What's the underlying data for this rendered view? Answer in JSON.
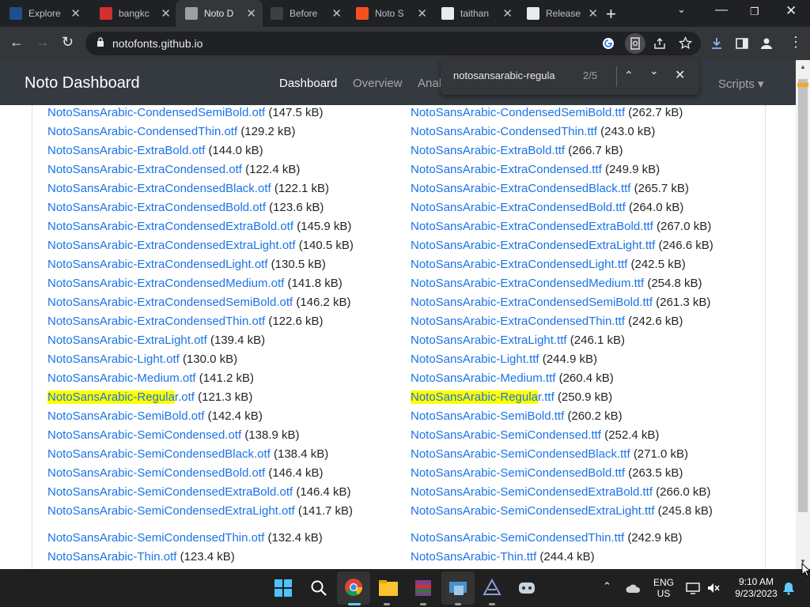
{
  "browser": {
    "tabs": [
      {
        "label": "Explore",
        "icon": "vmware-icon",
        "color": "#1d4f91"
      },
      {
        "label": "bangkc",
        "icon": "store-icon",
        "color": "#d32f2f"
      },
      {
        "label": "Noto D",
        "icon": "globe-icon",
        "color": "#9aa0a6"
      },
      {
        "label": "Before",
        "icon": "shield-icon",
        "color": "#3c4043"
      },
      {
        "label": "Noto S",
        "icon": "n-logo-icon",
        "color": "#f4511e"
      },
      {
        "label": "taithan",
        "icon": "github-icon",
        "color": "#e8eaed"
      },
      {
        "label": "Release",
        "icon": "github-icon",
        "color": "#e8eaed"
      }
    ],
    "url": "notofonts.github.io",
    "find": {
      "query": "notosansarabic-regula",
      "count": "2/5"
    }
  },
  "site": {
    "brand": "Noto Dashboard",
    "nav": [
      "Dashboard",
      "Overview",
      "Anal",
      "Scripts ▾"
    ]
  },
  "files": {
    "left": [
      {
        "name": "NotoSansArabic-CondensedSemiBold.otf",
        "size": "(147.5 kB)"
      },
      {
        "name": "NotoSansArabic-CondensedThin.otf",
        "size": "(129.2 kB)"
      },
      {
        "name": "NotoSansArabic-ExtraBold.otf",
        "size": "(144.0 kB)"
      },
      {
        "name": "NotoSansArabic-ExtraCondensed.otf",
        "size": "(122.4 kB)"
      },
      {
        "name": "NotoSansArabic-ExtraCondensedBlack.otf",
        "size": "(122.1 kB)"
      },
      {
        "name": "NotoSansArabic-ExtraCondensedBold.otf",
        "size": "(123.6 kB)"
      },
      {
        "name": "NotoSansArabic-ExtraCondensedExtraBold.otf",
        "size": "(145.9 kB)"
      },
      {
        "name": "NotoSansArabic-ExtraCondensedExtraLight.otf",
        "size": "(140.5 kB)"
      },
      {
        "name": "NotoSansArabic-ExtraCondensedLight.otf",
        "size": "(130.5 kB)"
      },
      {
        "name": "NotoSansArabic-ExtraCondensedMedium.otf",
        "size": "(141.8 kB)"
      },
      {
        "name": "NotoSansArabic-ExtraCondensedSemiBold.otf",
        "size": "(146.2 kB)"
      },
      {
        "name": "NotoSansArabic-ExtraCondensedThin.otf",
        "size": "(122.6 kB)"
      },
      {
        "name": "NotoSansArabic-ExtraLight.otf",
        "size": "(139.4 kB)"
      },
      {
        "name": "NotoSansArabic-Light.otf",
        "size": "(130.0 kB)"
      },
      {
        "name": "NotoSansArabic-Medium.otf",
        "size": "(141.2 kB)"
      },
      {
        "name": "NotoSansArabic-Regular.otf",
        "size": "(121.3 kB)",
        "highlight": "NotoSansArabic-Regula",
        "rest": "r.otf"
      },
      {
        "name": "NotoSansArabic-SemiBold.otf",
        "size": "(142.4 kB)"
      },
      {
        "name": "NotoSansArabic-SemiCondensed.otf",
        "size": "(138.9 kB)"
      },
      {
        "name": "NotoSansArabic-SemiCondensedBlack.otf",
        "size": "(138.4 kB)"
      },
      {
        "name": "NotoSansArabic-SemiCondensedBold.otf",
        "size": "(146.4 kB)"
      },
      {
        "name": "NotoSansArabic-SemiCondensedExtraBold.otf",
        "size": "(146.4 kB)"
      },
      {
        "name": "NotoSansArabic-SemiCondensedExtraLight.otf",
        "size": "(141.7 kB)"
      },
      {
        "name": "NotoSansArabic-SemiCondensedThin.otf",
        "size": "(132.4 kB)"
      },
      {
        "name": "NotoSansArabic-Thin.otf",
        "size": "(123.4 kB)"
      }
    ],
    "right": [
      {
        "name": "NotoSansArabic-CondensedSemiBold.ttf",
        "size": "(262.7 kB)"
      },
      {
        "name": "NotoSansArabic-CondensedThin.ttf",
        "size": "(243.0 kB)"
      },
      {
        "name": "NotoSansArabic-ExtraBold.ttf",
        "size": "(266.7 kB)"
      },
      {
        "name": "NotoSansArabic-ExtraCondensed.ttf",
        "size": "(249.9 kB)"
      },
      {
        "name": "NotoSansArabic-ExtraCondensedBlack.ttf",
        "size": "(265.7 kB)"
      },
      {
        "name": "NotoSansArabic-ExtraCondensedBold.ttf",
        "size": "(264.0 kB)"
      },
      {
        "name": "NotoSansArabic-ExtraCondensedExtraBold.ttf",
        "size": "(267.0 kB)"
      },
      {
        "name": "NotoSansArabic-ExtraCondensedExtraLight.ttf",
        "size": "(246.6 kB)"
      },
      {
        "name": "NotoSansArabic-ExtraCondensedLight.ttf",
        "size": "(242.5 kB)"
      },
      {
        "name": "NotoSansArabic-ExtraCondensedMedium.ttf",
        "size": "(254.8 kB)"
      },
      {
        "name": "NotoSansArabic-ExtraCondensedSemiBold.ttf",
        "size": "(261.3 kB)"
      },
      {
        "name": "NotoSansArabic-ExtraCondensedThin.ttf",
        "size": "(242.6 kB)"
      },
      {
        "name": "NotoSansArabic-ExtraLight.ttf",
        "size": "(246.1 kB)"
      },
      {
        "name": "NotoSansArabic-Light.ttf",
        "size": "(244.9 kB)"
      },
      {
        "name": "NotoSansArabic-Medium.ttf",
        "size": "(260.4 kB)"
      },
      {
        "name": "NotoSansArabic-Regular.ttf",
        "size": "(250.9 kB)",
        "highlight": "NotoSansArabic-Regula",
        "rest": "r.ttf"
      },
      {
        "name": "NotoSansArabic-SemiBold.ttf",
        "size": "(260.2 kB)"
      },
      {
        "name": "NotoSansArabic-SemiCondensed.ttf",
        "size": "(252.4 kB)"
      },
      {
        "name": "NotoSansArabic-SemiCondensedBlack.ttf",
        "size": "(271.0 kB)"
      },
      {
        "name": "NotoSansArabic-SemiCondensedBold.ttf",
        "size": "(263.5 kB)"
      },
      {
        "name": "NotoSansArabic-SemiCondensedExtraBold.ttf",
        "size": "(266.0 kB)"
      },
      {
        "name": "NotoSansArabic-SemiCondensedExtraLight.ttf",
        "size": "(245.8 kB)"
      },
      {
        "name": "NotoSansArabic-SemiCondensedThin.ttf",
        "size": "(242.9 kB)"
      },
      {
        "name": "NotoSansArabic-Thin.ttf",
        "size": "(244.4 kB)"
      }
    ]
  },
  "taskbar": {
    "lang_line1": "ENG",
    "lang_line2": "US",
    "time": "9:10 AM",
    "date": "9/23/2023"
  },
  "colors": {
    "link": "#1a73e8",
    "highlight": "#ffff00",
    "navbar": "#343a40"
  }
}
